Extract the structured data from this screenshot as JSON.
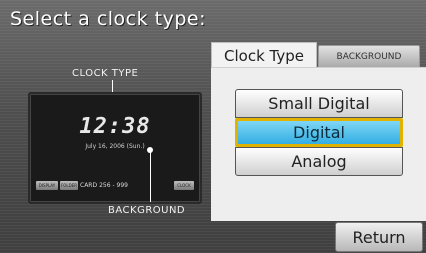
{
  "title": "Select a clock type:",
  "labels": {
    "clock_type": "CLOCK TYPE",
    "background": "BACKGROUND"
  },
  "preview": {
    "time": "12:38",
    "date": "July 16, 2006 (Sun.)",
    "bar": {
      "btn1": "DISPLAY",
      "btn2": "FOLDER",
      "text1": "CARD",
      "text2": "256 - 999",
      "btn3": "CLOCK"
    }
  },
  "tabs": {
    "clock_type": "Clock Type",
    "background": "BACKGROUND"
  },
  "options": [
    {
      "label": "Small Digital"
    },
    {
      "label": "Digital"
    },
    {
      "label": "Analog"
    }
  ],
  "selected_option": "Digital",
  "return_label": "Return",
  "colors": {
    "selected_fill": "#33aee3",
    "selected_border": "#e1b300"
  }
}
